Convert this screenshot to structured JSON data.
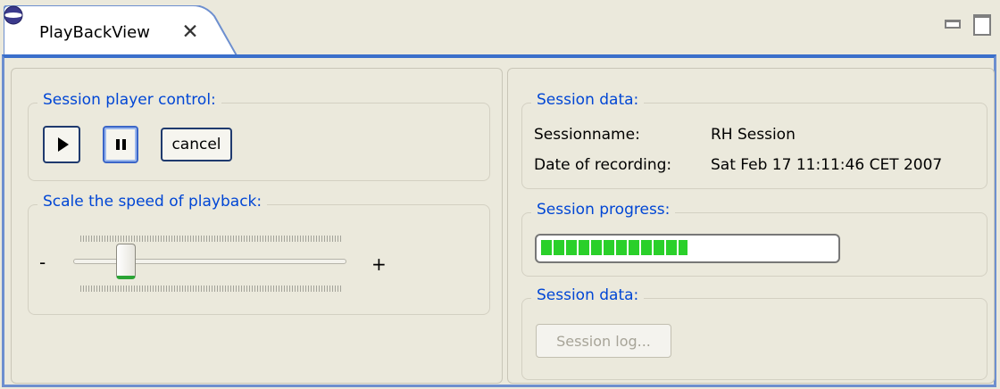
{
  "view": {
    "title": "PlayBackView",
    "close_glyph": "✕",
    "icon": "eclipse-view-icon",
    "minimize_icon": "minimize-icon",
    "maximize_icon": "maximize-icon"
  },
  "player_control": {
    "title": "Session player control:",
    "play_icon": "play-icon",
    "pause_icon": "pause-icon",
    "cancel_label": "cancel"
  },
  "speed": {
    "title": "Scale the speed of playback:",
    "minus_label": "-",
    "plus_label": "+",
    "value_fraction": 0.17
  },
  "session_data": {
    "title": "Session data:",
    "name_label": "Sessionname:",
    "name_value": "RH Session",
    "date_label": "Date of recording:",
    "date_value": "Sat Feb 17 11:11:46 CET 2007"
  },
  "progress": {
    "title": "Session progress:",
    "value_fraction": 0.5
  },
  "session_log": {
    "title": "Session data:",
    "button_label": "Session log..."
  },
  "colors": {
    "group_title": "#0046d5",
    "frame": "#3a6fcb",
    "progress_fill": "#2ad02a",
    "slider_thumb_accent": "#2aa435"
  }
}
